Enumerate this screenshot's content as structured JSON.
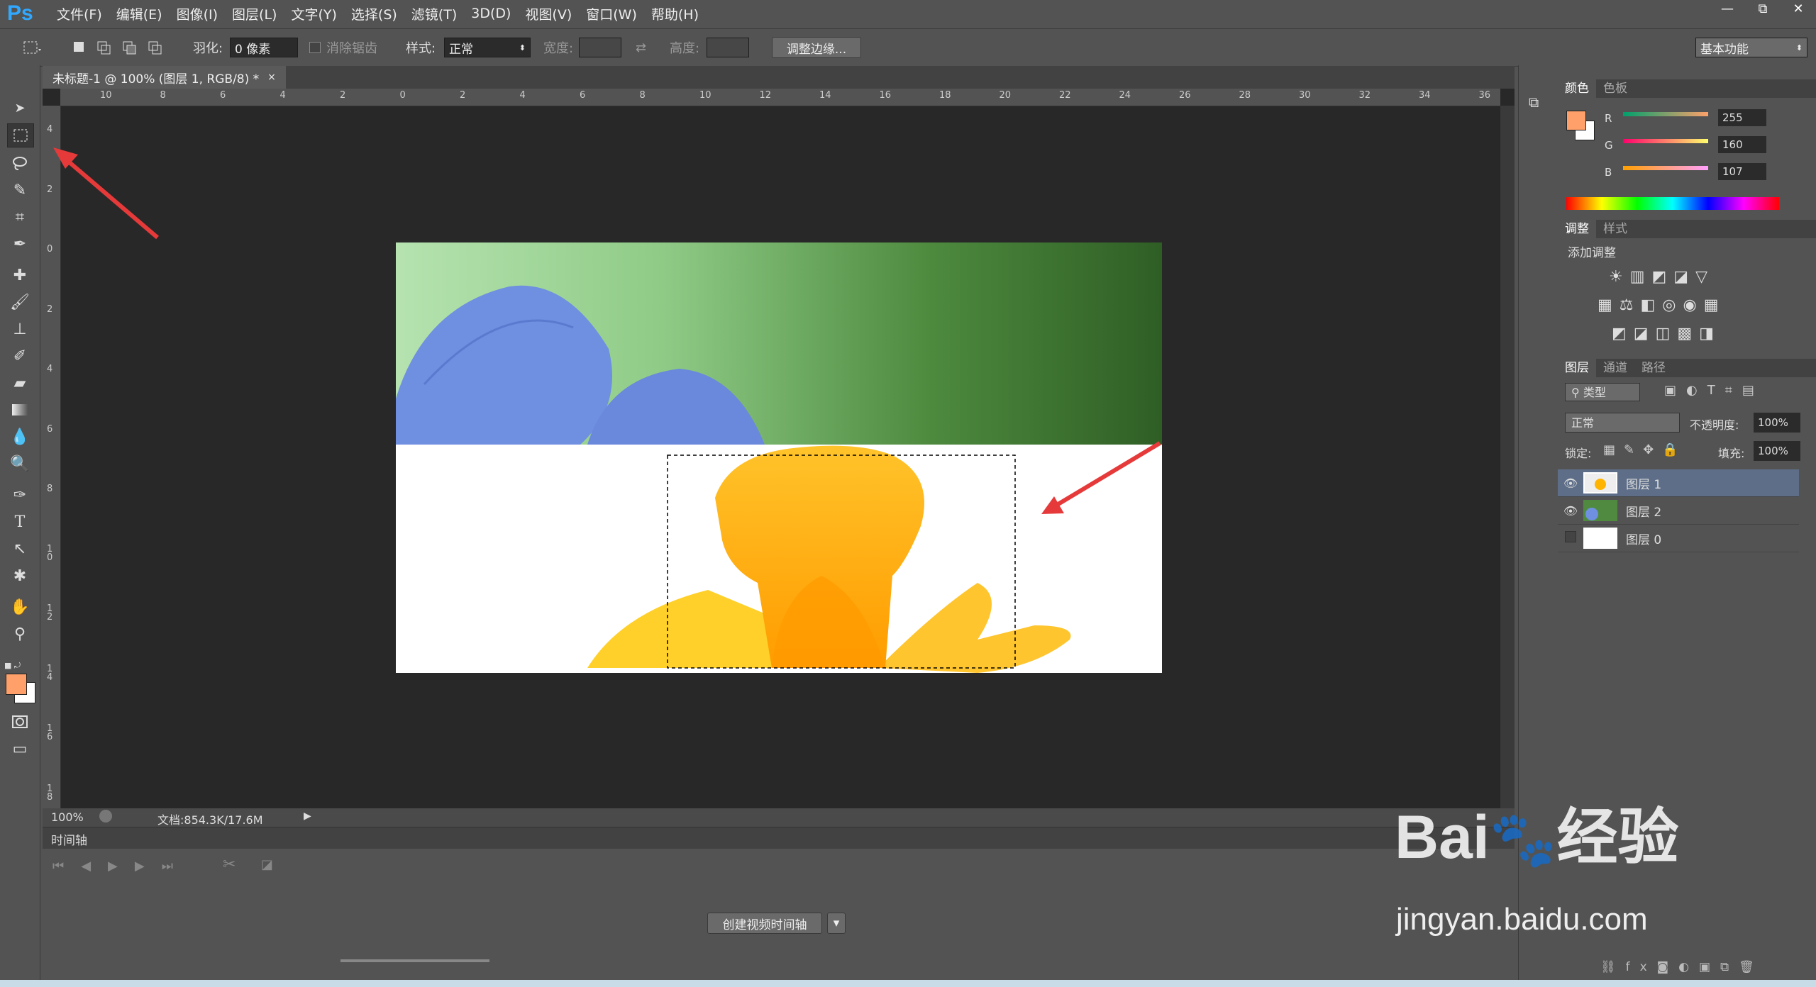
{
  "app": {
    "logo": "Ps"
  },
  "menu": [
    "文件(F)",
    "编辑(E)",
    "图像(I)",
    "图层(L)",
    "文字(Y)",
    "选择(S)",
    "滤镜(T)",
    "3D(D)",
    "视图(V)",
    "窗口(W)",
    "帮助(H)"
  ],
  "window_controls": [
    "—",
    "⧉",
    "✕"
  ],
  "options": {
    "feather_label": "羽化:",
    "feather_value": "0 像素",
    "antialias_label": "消除锯齿",
    "style_label": "样式:",
    "style_value": "正常",
    "width_label": "宽度:",
    "height_label": "高度:",
    "refine_edge": "调整边缘...",
    "workspace": "基本功能"
  },
  "document": {
    "tab_title": "未标题-1 @ 100% (图层 1, RGB/8) *",
    "zoom": "100%",
    "doc_info": "文档:854.3K/17.6M"
  },
  "ruler": {
    "h_ticks": [
      "10",
      "8",
      "6",
      "4",
      "2",
      "0",
      "2",
      "4",
      "6",
      "8",
      "10",
      "12",
      "14",
      "16",
      "18",
      "20",
      "22",
      "24",
      "26",
      "28",
      "30",
      "32",
      "34",
      "36"
    ],
    "v_ticks": [
      "4",
      "2",
      "0",
      "2",
      "4",
      "6",
      "8",
      "1 0",
      "1 2",
      "1 4",
      "1 6",
      "1 8"
    ]
  },
  "timeline": {
    "title": "时间轴",
    "create_button": "创建视频时间轴"
  },
  "color_panel": {
    "tabs": [
      "颜色",
      "色板"
    ],
    "fg_color": "#ffa06b",
    "channels": [
      {
        "label": "R",
        "value": "255"
      },
      {
        "label": "G",
        "value": "160"
      },
      {
        "label": "B",
        "value": "107"
      }
    ]
  },
  "adjust_panel": {
    "tabs": [
      "调整",
      "样式"
    ],
    "heading": "添加调整"
  },
  "layers_panel": {
    "tabs": [
      "图层",
      "通道",
      "路径"
    ],
    "filter_kind": "类型",
    "blend_mode": "正常",
    "opacity_label": "不透明度:",
    "opacity_value": "100%",
    "lock_label": "锁定:",
    "fill_label": "填充:",
    "fill_value": "100%",
    "layers": [
      {
        "name": "图层 1",
        "visible": true,
        "selected": true
      },
      {
        "name": "图层 2",
        "visible": true,
        "selected": false
      },
      {
        "name": "图层 0",
        "visible": false,
        "selected": false
      }
    ]
  },
  "watermark": {
    "text": "jingyan.baidu.com"
  }
}
